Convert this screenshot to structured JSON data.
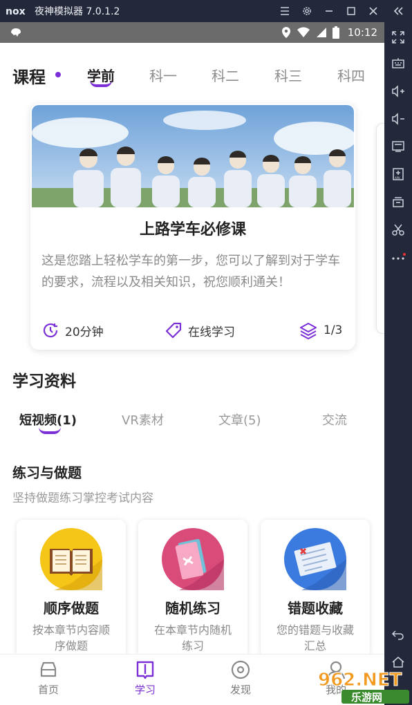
{
  "window": {
    "title": "夜神模拟器 7.0.1.2",
    "logo_text": "nox"
  },
  "statusbar": {
    "time": "10:12"
  },
  "course": {
    "title": "课程",
    "tabs": [
      {
        "label": "学前",
        "active": true
      },
      {
        "label": "科一",
        "active": false
      },
      {
        "label": "科二",
        "active": false
      },
      {
        "label": "科三",
        "active": false
      },
      {
        "label": "科四",
        "active": false
      }
    ],
    "card": {
      "title": "上路学车必修课",
      "description": "这是您踏上轻松学车的第一步，您可以了解到对于学车的要求，流程以及相关知识，祝您顺利通关！",
      "duration": "20分钟",
      "mode": "在线学习",
      "progress": "1/3"
    }
  },
  "materials": {
    "title": "学习资料",
    "tabs": [
      {
        "label": "短视频(1)",
        "active": true
      },
      {
        "label": "VR素材",
        "active": false
      },
      {
        "label": "文章(5)",
        "active": false
      },
      {
        "label": "交流",
        "active": false
      }
    ]
  },
  "practice": {
    "title": "练习与做题",
    "subtitle": "坚持做题练习掌控考试内容",
    "cards": [
      {
        "title": "顺序做题",
        "description": "按本章节内容顺序做题",
        "icon": "open-book-icon",
        "color": "#f5c518"
      },
      {
        "title": "随机练习",
        "description": "在本章节内随机练习",
        "icon": "shuffle-book-icon",
        "color": "#d94c7a"
      },
      {
        "title": "错题收藏",
        "description": "您的错题与收藏汇总",
        "icon": "wrong-answers-icon",
        "color": "#3b7be0"
      }
    ]
  },
  "bottom_nav": [
    {
      "label": "首页",
      "icon": "car-icon",
      "active": false
    },
    {
      "label": "学习",
      "icon": "book-icon",
      "active": true
    },
    {
      "label": "发现",
      "icon": "discover-icon",
      "active": false
    },
    {
      "label": "我的",
      "icon": "profile-icon",
      "active": false
    }
  ],
  "watermark": {
    "text": "962.NET",
    "subtext": "乐游网"
  },
  "colors": {
    "accent": "#7b2fd6",
    "titlebar": "#23283a",
    "statusbar": "#6b6b6b"
  }
}
